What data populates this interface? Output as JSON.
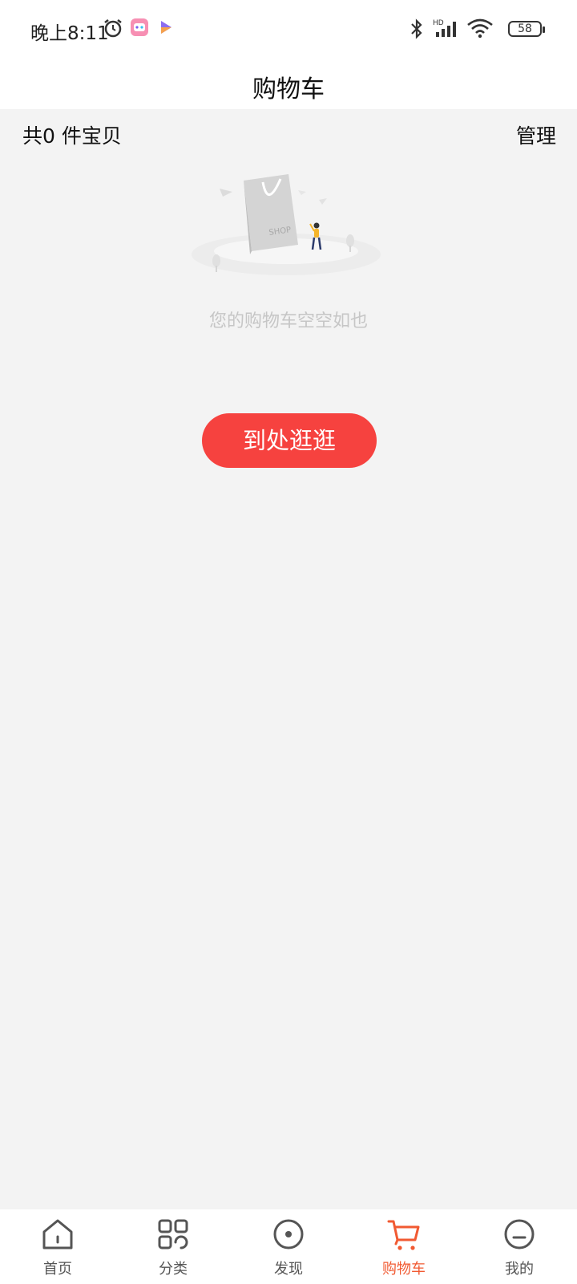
{
  "status_bar": {
    "time": "晚上8:11",
    "battery": "58",
    "icons": [
      "alarm-icon",
      "game-app-icon",
      "video-app-icon",
      "bluetooth-icon",
      "signal-icon",
      "wifi-icon",
      "battery-icon"
    ]
  },
  "header": {
    "title": "购物车"
  },
  "sub_header": {
    "count_label": "共0 件宝贝",
    "manage_label": "管理"
  },
  "empty_state": {
    "illustration_text": "SHOP",
    "message": "您的购物车空空如也",
    "button_label": "到处逛逛"
  },
  "tab_bar": {
    "items": [
      {
        "label": "首页",
        "icon": "home-icon"
      },
      {
        "label": "分类",
        "icon": "category-icon"
      },
      {
        "label": "发现",
        "icon": "discover-icon"
      },
      {
        "label": "购物车",
        "icon": "cart-icon"
      },
      {
        "label": "我的",
        "icon": "profile-icon"
      }
    ],
    "active_index": 3,
    "active_color": "#f15a32",
    "inactive_color": "#555555"
  },
  "colors": {
    "accent": "#f6423f",
    "background": "#f3f3f3"
  }
}
